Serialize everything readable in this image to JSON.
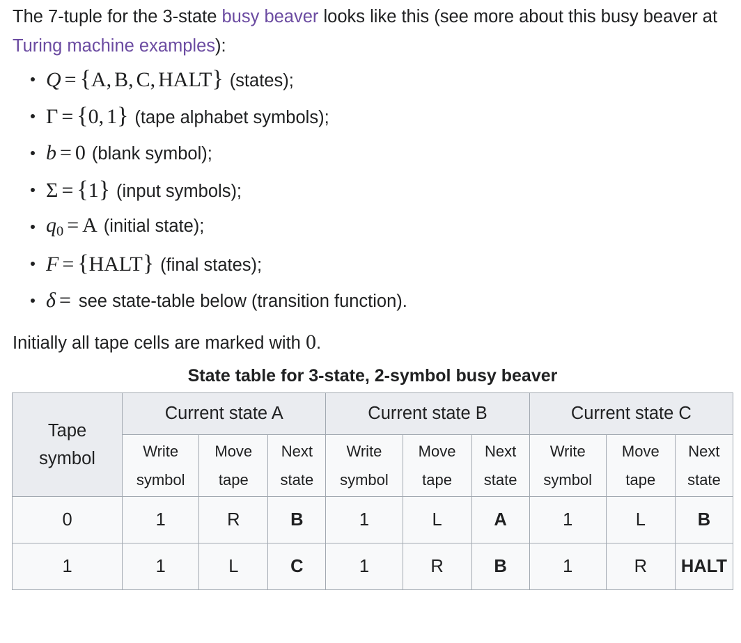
{
  "intro": {
    "part1": "The 7-tuple for the 3-state ",
    "link1": "busy beaver",
    "part2": " looks like this (see more about this busy beaver at ",
    "link2": "Turing machine examples",
    "part3": "):"
  },
  "tuple_items": [
    {
      "symbol": "Q",
      "symbol_style": "italic",
      "relation": "=",
      "value_open": "{",
      "value_items": [
        "A",
        "B",
        "C",
        "HALT"
      ],
      "value_close": "}",
      "description": "(states);"
    },
    {
      "symbol": "Γ",
      "symbol_style": "upright",
      "relation": "=",
      "value_open": "{",
      "value_items": [
        "0",
        "1"
      ],
      "value_close": "}",
      "description": "(tape alphabet symbols);"
    },
    {
      "symbol": "b",
      "symbol_style": "italic",
      "relation": "=",
      "value_open": "",
      "value_items": [
        "0"
      ],
      "value_close": "",
      "description": "(blank symbol);"
    },
    {
      "symbol": "Σ",
      "symbol_style": "upright",
      "relation": "=",
      "value_open": "{",
      "value_items": [
        "1"
      ],
      "value_close": "}",
      "description": "(input symbols);"
    },
    {
      "symbol": "q",
      "symbol_subscript": "0",
      "symbol_style": "italic",
      "relation": "=",
      "value_open": "",
      "value_items": [
        "A"
      ],
      "value_close": "",
      "description": "(initial state);"
    },
    {
      "symbol": "F",
      "symbol_style": "italic",
      "relation": "=",
      "value_open": "{",
      "value_items": [
        "HALT"
      ],
      "value_close": "}",
      "description": "(final states);"
    },
    {
      "symbol": "δ",
      "symbol_style": "italic",
      "relation": "=",
      "value_open": "",
      "value_items": [],
      "value_close": "",
      "description": "see state-table below (transition function)."
    }
  ],
  "initial_note": {
    "text_before": "Initially all tape cells are marked with ",
    "math_value": "0",
    "text_after": "."
  },
  "table": {
    "caption": "State table for 3-state, 2-symbol busy beaver",
    "corner_header_line1": "Tape",
    "corner_header_line2": "symbol",
    "group_headers": [
      "Current state A",
      "Current state B",
      "Current state C"
    ],
    "sub_headers": [
      {
        "line1": "Write",
        "line2": "symbol"
      },
      {
        "line1": "Move",
        "line2": "tape"
      },
      {
        "line1": "Next",
        "line2": "state"
      },
      {
        "line1": "Write",
        "line2": "symbol"
      },
      {
        "line1": "Move",
        "line2": "tape"
      },
      {
        "line1": "Next",
        "line2": "state"
      },
      {
        "line1": "Write",
        "line2": "symbol"
      },
      {
        "line1": "Move",
        "line2": "tape"
      },
      {
        "line1": "Next",
        "line2": "state"
      }
    ],
    "rows": [
      {
        "tape_symbol": "0",
        "cells": [
          "1",
          "R",
          "B",
          "1",
          "L",
          "A",
          "1",
          "L",
          "B"
        ]
      },
      {
        "tape_symbol": "1",
        "cells": [
          "1",
          "L",
          "C",
          "1",
          "R",
          "B",
          "1",
          "R",
          "HALT"
        ]
      }
    ]
  },
  "colors": {
    "link": "#6b4ba1",
    "text": "#202122",
    "table_border": "#a2a9b1",
    "header_bg": "#eaecf0",
    "cell_bg": "#f8f9fa",
    "page_bg": "#ffffff"
  }
}
